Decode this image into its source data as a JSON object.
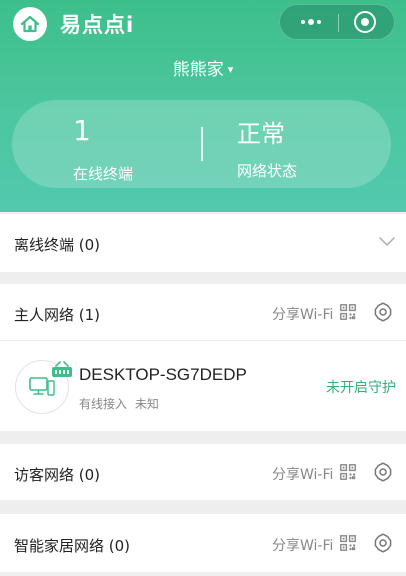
{
  "app": {
    "title": "易点点i",
    "home_name": "熊熊家",
    "home_caret": "▾"
  },
  "stats": {
    "online_count": "1",
    "online_label": "在线终端",
    "network_status": "正常",
    "network_status_label": "网络状态"
  },
  "offline": {
    "label": "离线终端 (0)"
  },
  "networks": {
    "share_label": "分享Wi-Fi",
    "host": {
      "label": "主人网络 (1)"
    },
    "guest": {
      "label": "访客网络 (0)"
    },
    "smart_home": {
      "label": "智能家居网络 (0)"
    }
  },
  "device": {
    "name": "DESKTOP-SG7DEDP",
    "connection": "有线接入",
    "extra": "未知",
    "status": "未开启守护"
  },
  "colors": {
    "accent": "#3dbf8b",
    "status_green": "#2fb27b",
    "muted_text": "#888888",
    "background": "#eeeeee"
  },
  "icons": {
    "home": "home-icon",
    "more": "more-dots-icon",
    "target": "target-icon",
    "chevron": "chevron-down-icon",
    "qr": "qr-code-icon",
    "gear": "gear-icon",
    "computer": "computer-icon",
    "router": "router-icon"
  }
}
